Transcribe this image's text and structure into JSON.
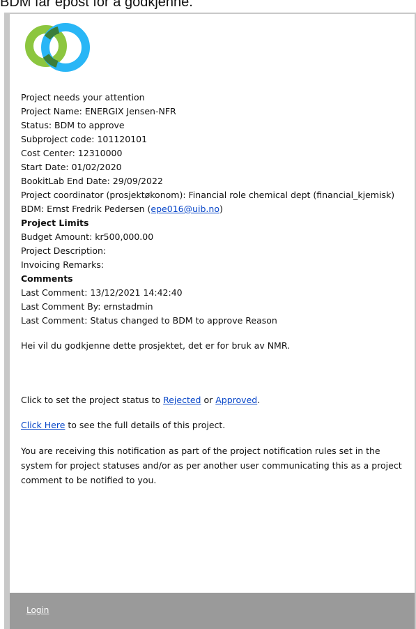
{
  "caption": "BDM får epost for å godkjenne.",
  "colors": {
    "logo_green": "#8cc63f",
    "logo_blue": "#29b6f6",
    "logo_overlap": "#3a7d3a",
    "footer_bg": "#9a9a9a",
    "link": "#0645c8"
  },
  "email": {
    "heading": "Project needs your attention",
    "project_name": "Project Name: ENERGIX Jensen-NFR",
    "status": "Status: BDM to approve",
    "subproject_code": "Subproject code: 101120101",
    "cost_center": "Cost Center: 12310000",
    "start_date": "Start Date: 01/02/2020",
    "end_date": "BookitLab End Date: 29/09/2022",
    "coordinator": "Project coordinator (prosjektøkonom): Financial role chemical dept (financial_kjemisk)",
    "bdm_prefix": "BDM: Ernst Fredrik Pedersen (",
    "bdm_email": "epe016@uib.no",
    "bdm_suffix": ")",
    "limits_heading": "Project Limits",
    "budget": "Budget Amount: kr500,000.00",
    "description": "Project Description:",
    "invoicing": "Invoicing Remarks:",
    "comments_heading": "Comments",
    "last_comment_date": "Last Comment: 13/12/2021 14:42:40",
    "last_comment_by": "Last Comment By: ernstadmin",
    "last_comment_text": "Last Comment: Status changed to BDM to approve Reason",
    "message": "Hei vil du godkjenne dette prosjektet, det er for bruk av NMR.",
    "set_status_prefix": "Click to set the project status to ",
    "rejected_link": "Rejected",
    "or_text": " or ",
    "approved_link": "Approved",
    "period": ".",
    "click_here_link": "Click Here",
    "details_text": " to see the full details of this project.",
    "notice": "You are receiving this notification as part of the project notification rules set in the system for project statuses and/or as per another user communicating this as a project comment to be notified to you."
  },
  "footer": {
    "login_link": "Login"
  }
}
